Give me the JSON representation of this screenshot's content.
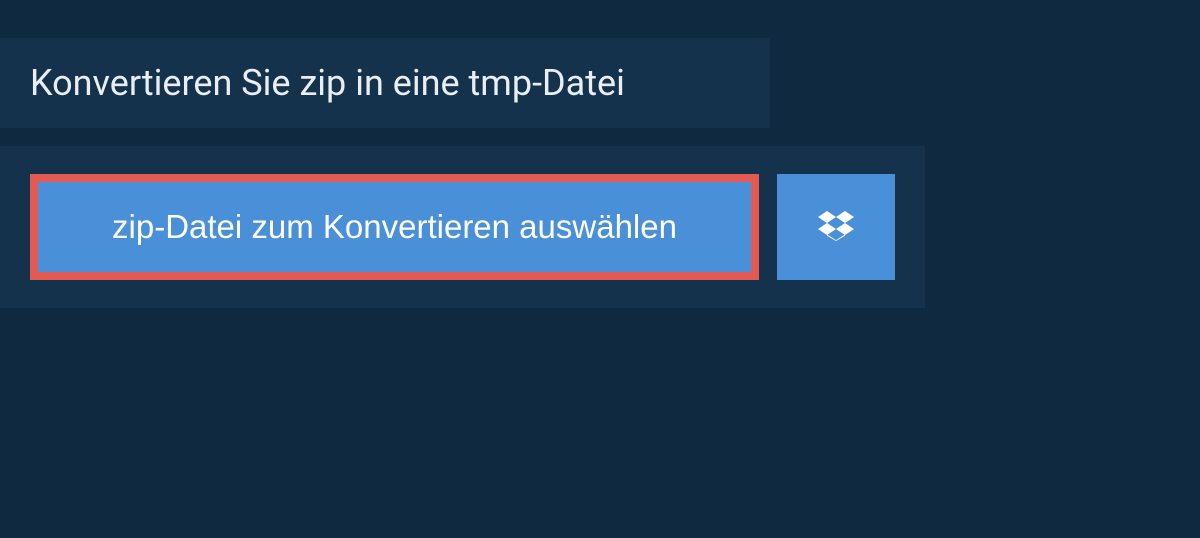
{
  "header": {
    "title": "Konvertieren Sie zip in eine tmp-Datei"
  },
  "upload": {
    "select_label": "zip-Datei zum Konvertieren auswählen",
    "dropbox_icon": "dropbox-icon"
  },
  "colors": {
    "page_bg": "#0f2a40",
    "panel_bg": "#14324b",
    "button_bg": "#4a90d9",
    "highlight_border": "#e35a52",
    "text_light": "#e8eef3"
  }
}
